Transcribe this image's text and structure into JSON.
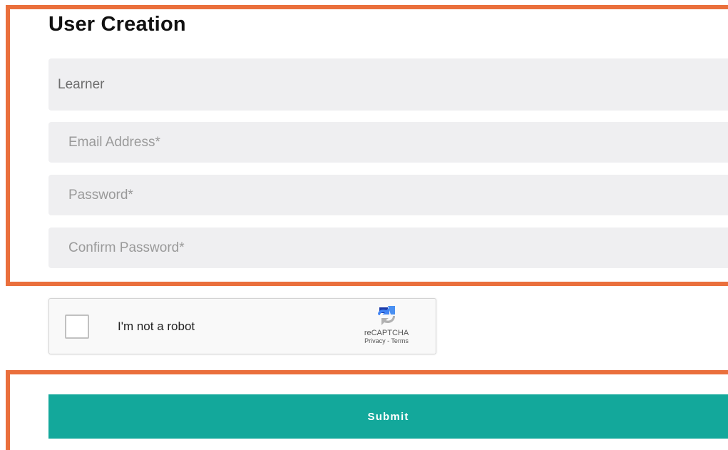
{
  "form": {
    "title": "User Creation",
    "role_value": "Learner",
    "email_placeholder": "Email Address*",
    "password_placeholder": "Password*",
    "confirm_password_placeholder": "Confirm Password*"
  },
  "captcha": {
    "label": "I'm not a robot",
    "brand": "reCAPTCHA",
    "links": "Privacy - Terms",
    "checked": false,
    "logo_icon": "recaptcha-logo-icon"
  },
  "actions": {
    "submit_label": "Submit"
  },
  "colors": {
    "highlight": "#ea6f3c",
    "submit": "#13a89b",
    "field_bg": "#efeff1"
  }
}
